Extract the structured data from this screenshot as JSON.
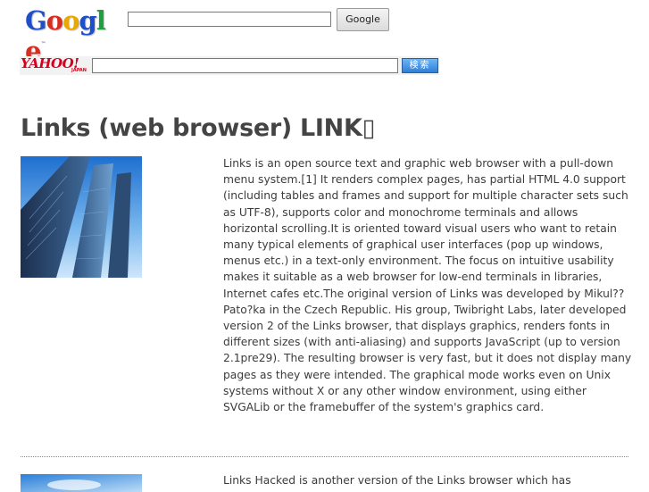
{
  "google": {
    "logo_letters": [
      "G",
      "o",
      "o",
      "g",
      "l",
      "e"
    ],
    "logo_colors": [
      "#1f4fc6",
      "#d62d20",
      "#e8a800",
      "#1f4fc6",
      "#1e9e3f",
      "#d62d20"
    ],
    "logo_tm": "™",
    "search_value": "",
    "button_label": "Google"
  },
  "yahoo": {
    "logo_text": "YAHOO!",
    "logo_sub": "JAPAN",
    "search_value": "",
    "button_label": "検索"
  },
  "article": {
    "title": "Links (web browser) LINK▯",
    "image_icon": "skyscraper-photo",
    "body": "Links is an open source text and graphic web browser with a pull-down menu system.[1] It renders complex pages, has partial HTML 4.0 support (including tables and frames and support for multiple character sets such as UTF-8), supports color and monochrome terminals and allows horizontal scrolling.It is oriented toward visual users who want to retain many typical elements of graphical user interfaces (pop up windows, menus etc.) in a text-only environment. The focus on intuitive usability makes it suitable as a web browser for low-end terminals in libraries, Internet cafes etc.The original version of Links was developed by Mikul?? Pato?ka in the Czech Republic. His group, Twibright Labs, later developed version 2 of the Links browser, that displays graphics, renders fonts in different sizes (with anti-aliasing) and supports JavaScript (up to version 2.1pre29). The resulting browser is very fast, but it does not display many pages as they were intended. The graphical mode works even on Unix systems without X or any other window environment, using either SVGALib or the framebuffer of the system's graphics card."
  },
  "article2": {
    "image_icon": "sky-photo",
    "body": "Links Hacked is another version of the Links browser which has"
  }
}
